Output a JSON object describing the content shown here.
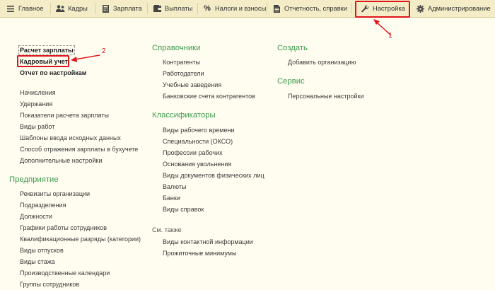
{
  "nav": {
    "items": [
      {
        "label": "Главное",
        "icon": "hamburger-icon"
      },
      {
        "label": "Кадры",
        "icon": "people-icon"
      },
      {
        "label": "Зарплата",
        "icon": "calculator-icon"
      },
      {
        "label": "Выплаты",
        "icon": "wallet-icon"
      },
      {
        "label": "Налоги и взносы",
        "icon": "percent-icon"
      },
      {
        "label": "Отчетность, справки",
        "icon": "document-icon"
      },
      {
        "label": "Настройка",
        "icon": "wrench-icon"
      },
      {
        "label": "Администрирование",
        "icon": "gear-icon"
      }
    ]
  },
  "left": {
    "top_links": [
      "Расчет зарплаты",
      "Кадровый учет",
      "Отчет по настройкам"
    ],
    "links": [
      "Начисления",
      "Удержания",
      "Показатели расчета зарплаты",
      "Виды работ",
      "Шаблоны ввода исходных данных",
      "Способ отражения зарплаты в бухучете",
      "Дополнительные настройки"
    ],
    "enterprise": {
      "title": "Предприятие",
      "items": [
        "Реквизиты организации",
        "Подразделения",
        "Должности",
        "Графики работы сотрудников",
        "Квалификационные разряды (категории)",
        "Виды отпусков",
        "Виды стажа",
        "Производственные календари",
        "Группы сотрудников"
      ]
    }
  },
  "middle": {
    "directories": {
      "title": "Справочники",
      "items": [
        "Контрагенты",
        "Работодатели",
        "Учебные заведения",
        "Банковские счета контрагентов"
      ]
    },
    "classifiers": {
      "title": "Классификаторы",
      "items": [
        "Виды рабочего времени",
        "Специальности (ОКСО)",
        "Профессии рабочих",
        "Основания увольнения",
        "Виды документов физических лиц",
        "Валюты",
        "Банки",
        "Виды справок"
      ]
    },
    "see_also": {
      "title": "См. также",
      "items": [
        "Виды контактной информации",
        "Прожиточные минимумы"
      ]
    }
  },
  "right": {
    "create": {
      "title": "Создать",
      "items": [
        "Добавить организацию"
      ]
    },
    "service": {
      "title": "Сервис",
      "items": [
        "Персональные настройки"
      ]
    }
  },
  "callouts": {
    "one": "1",
    "two": "2"
  },
  "colors": {
    "accent_green": "#3e9a4f",
    "highlight_red": "#e0141c",
    "nav_bg": "#f3ecc6",
    "page_bg": "#fffdf0"
  }
}
